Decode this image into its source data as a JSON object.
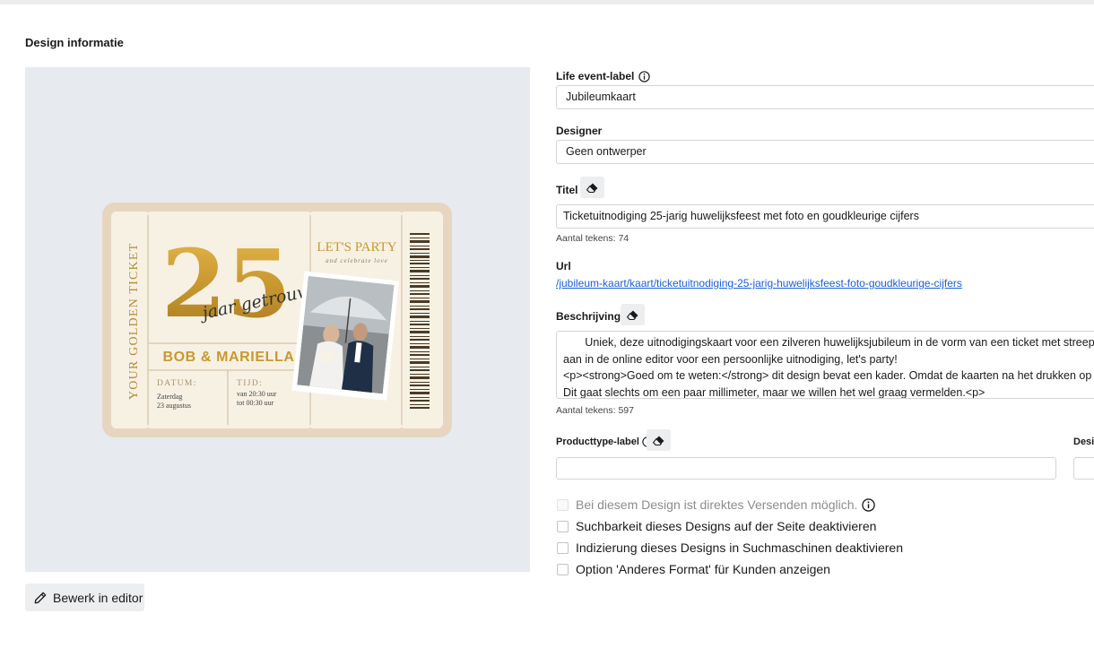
{
  "section": {
    "title": "Design informatie"
  },
  "preview": {
    "card": {
      "side_text": "YOUR GOLDEN TICKET",
      "number": "25",
      "script_text": "jaar getrouwd",
      "lets_party": "LET'S PARTY",
      "celebrate": "and celebrate love",
      "names": "BOB & MARIELLA",
      "datum_label": "DATUM:",
      "datum_line1": "Zaterdag",
      "datum_line2": "23 augustus",
      "tijd_label": "TIJD:",
      "tijd_line1": "van 20:30 uur",
      "tijd_line2": "tot 00:30 uur"
    },
    "edit_button": "Bewerk in editor"
  },
  "form": {
    "life_event": {
      "label": "Life event-label",
      "value": "Jubileumkaart"
    },
    "designer": {
      "label": "Designer",
      "value": "Geen ontwerper"
    },
    "titel": {
      "label": "Titel",
      "value": "Ticketuitnodiging 25-jarig huwelijksfeest met foto en goudkleurige cijfers",
      "counter": "Aantal tekens: 74"
    },
    "url": {
      "label": "Url",
      "value": "/jubileum-kaart/kaart/ticketuitnodiging-25-jarig-huwelijksfeest-foto-goudkleurige-cijfers"
    },
    "beschrijving": {
      "label": "Beschrijving",
      "value": "       Uniek, deze uitnodigingskaart voor een zilveren huwelijksjubileum in de vorm van een ticket met streepjescode! U\naan in de online editor voor een persoonlijke uitnodiging, let's party!\n<p><strong>Goed om te weten:</strong> dit design bevat een kader. Omdat de kaarten na het drukken op een groot v\nDit gaat slechts om een paar millimeter, maar we willen het wel graag vermelden.<p>",
      "counter": "Aantal tekens: 597"
    },
    "producttype": {
      "label": "Producttype-label",
      "value": ""
    },
    "design_cut_label": "Desi",
    "checkboxes": [
      {
        "label": "Bei diesem Design ist direktes Versenden möglich.",
        "checked": false,
        "disabled": true
      },
      {
        "label": "Suchbarkeit dieses Designs auf der Seite deaktivieren",
        "checked": false,
        "disabled": false
      },
      {
        "label": "Indizierung dieses Designs in Suchmaschinen deaktivieren",
        "checked": false,
        "disabled": false
      },
      {
        "label": "Option 'Anderes Format' für Kunden anzeigen",
        "checked": false,
        "disabled": false
      }
    ]
  },
  "colors": {
    "gold": "#c9982f",
    "card_bg": "#f7f1e4",
    "card_border": "#e7d6bf",
    "link": "#1a5fd6",
    "panel": "#e7eaee"
  },
  "icons": [
    "info-icon",
    "eraser-icon",
    "pencil-icon",
    "barcode-icon"
  ]
}
